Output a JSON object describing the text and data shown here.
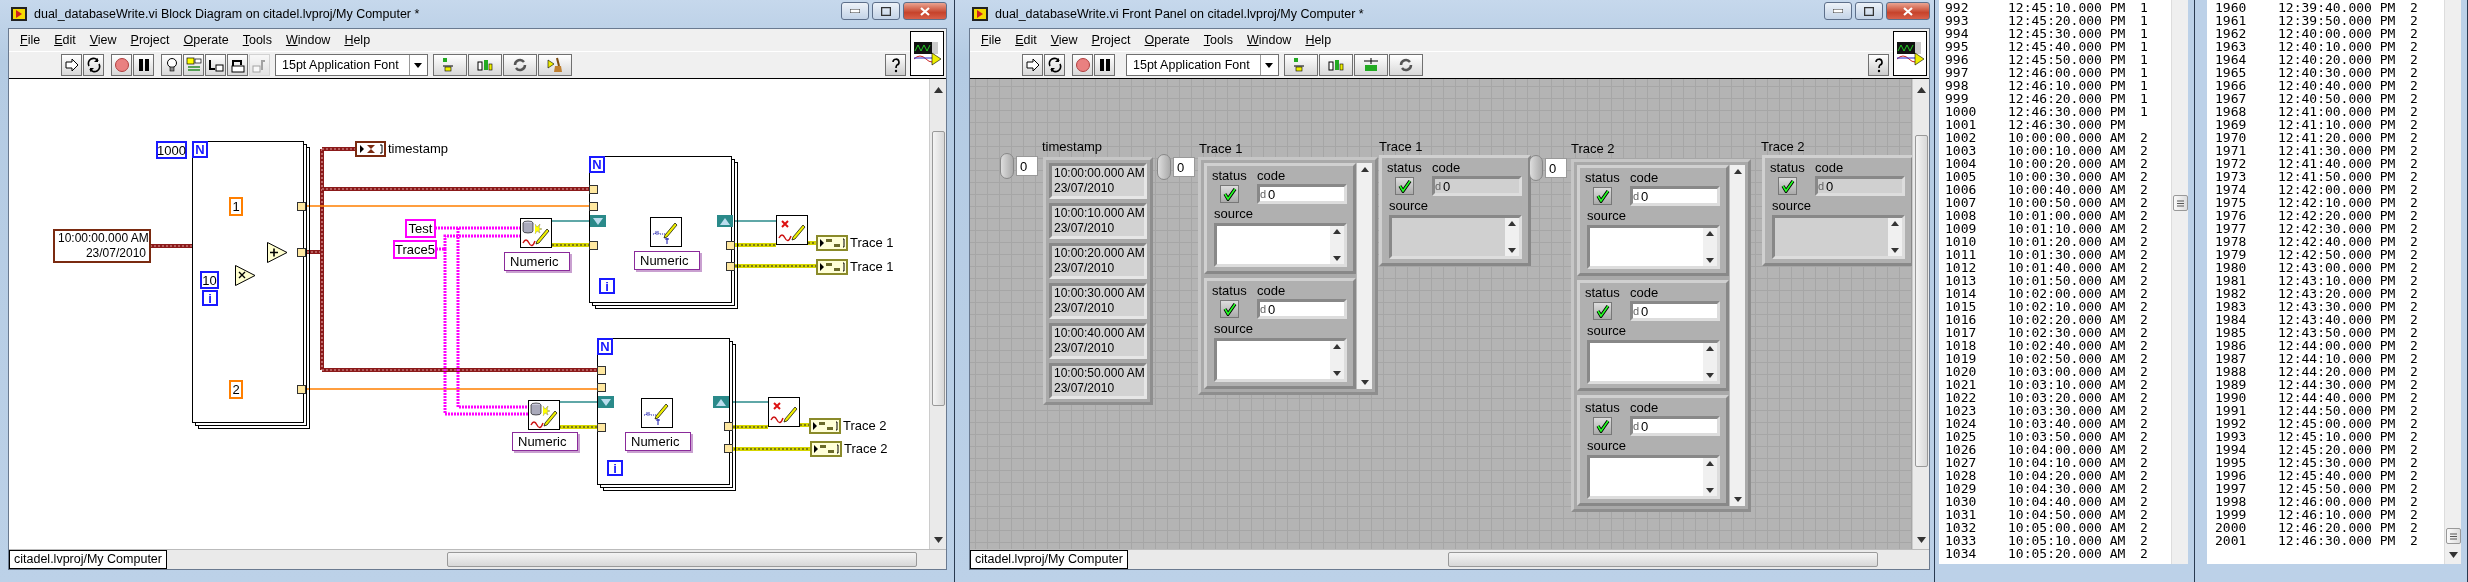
{
  "block_diagram": {
    "window_title": "dual_databaseWrite.vi Block Diagram on citadel.lvproj/My Computer *",
    "menu": [
      "File",
      "Edit",
      "View",
      "Project",
      "Operate",
      "Tools",
      "Window",
      "Help"
    ],
    "toolbar": {
      "buttons": [
        {
          "kind": "run",
          "disabled": false
        },
        {
          "kind": "run_continuously",
          "disabled": false
        },
        {
          "kind": "abort",
          "disabled": false
        },
        {
          "kind": "pause",
          "disabled": false
        },
        {
          "kind": "highlight",
          "disabled": false
        },
        {
          "kind": "retain_wire_values",
          "disabled": false
        },
        {
          "kind": "step_into",
          "disabled": false
        },
        {
          "kind": "step_over",
          "disabled": false
        },
        {
          "kind": "step_out",
          "disabled": true
        }
      ],
      "font": "15pt Application Font",
      "tools": [
        {
          "kind": "align",
          "disabled": false
        },
        {
          "kind": "distribute",
          "disabled": false
        },
        {
          "kind": "reorder",
          "disabled": false
        },
        {
          "kind": "clean_up",
          "disabled": false
        }
      ]
    },
    "loop_count_constant": "1000",
    "loops": [
      {
        "count_terminal": "N",
        "iteration_terminal": "i"
      },
      {
        "count_terminal": "N",
        "iteration_terminal": "i"
      },
      {
        "count_terminal": "N",
        "iteration_terminal": "i"
      }
    ],
    "timestamp_constant": [
      "10:00:00.000 AM",
      "23/07/2010"
    ],
    "array_constants": [
      "1",
      "2"
    ],
    "multiplier_constant": "10",
    "timestamp_indicator_label": "timestamp",
    "string_constants": [
      "Test",
      "Trace5"
    ],
    "type_selectors": [
      "Numeric",
      "Numeric",
      "Numeric",
      "Numeric"
    ],
    "error_indicator_labels": [
      "Trace 1",
      "Trace 1",
      "Trace 2",
      "Trace 2"
    ],
    "status_bar": "citadel.lvproj/My Computer"
  },
  "front_panel": {
    "window_title": "dual_databaseWrite.vi Front Panel on citadel.lvproj/My Computer *",
    "menu": [
      "File",
      "Edit",
      "View",
      "Project",
      "Operate",
      "Tools",
      "Window",
      "Help"
    ],
    "toolbar": {
      "buttons": [
        {
          "kind": "run",
          "disabled": false
        },
        {
          "kind": "run_continuously",
          "disabled": false
        },
        {
          "kind": "abort",
          "disabled": false
        },
        {
          "kind": "pause",
          "disabled": false
        }
      ],
      "font": "15pt Application Font",
      "tools": [
        {
          "kind": "align",
          "disabled": false
        },
        {
          "kind": "distribute",
          "disabled": false
        },
        {
          "kind": "resize",
          "disabled": false
        },
        {
          "kind": "reorder",
          "disabled": false
        }
      ]
    },
    "controls": [
      {
        "kind": "timestamp_array",
        "label": "timestamp",
        "index": "0",
        "elements": [
          [
            "10:00:00.000 AM",
            "23/07/2010"
          ],
          [
            "10:00:10.000 AM",
            "23/07/2010"
          ],
          [
            "10:00:20.000 AM",
            "23/07/2010"
          ],
          [
            "10:00:30.000 AM",
            "23/07/2010"
          ],
          [
            "10:00:40.000 AM",
            "23/07/2010"
          ],
          [
            "10:00:50.000 AM",
            "23/07/2010"
          ]
        ]
      },
      {
        "kind": "error_array",
        "label": "Trace 1",
        "index": "0",
        "elements": [
          {
            "status_label": "status",
            "status": true,
            "code_label": "code",
            "radix": "d",
            "code": "0",
            "source_label": "source"
          },
          {
            "status_label": "status",
            "status": true,
            "code_label": "code",
            "radix": "d",
            "code": "0",
            "source_label": "source"
          }
        ]
      },
      {
        "kind": "error_indicator",
        "label": "Trace 1",
        "element": {
          "status_label": "status",
          "status": true,
          "code_label": "code",
          "radix": "d",
          "code": "0",
          "source_label": "source"
        }
      },
      {
        "kind": "error_array",
        "label": "Trace 2",
        "index": "0",
        "elements": [
          {
            "status_label": "status",
            "status": true,
            "code_label": "code",
            "radix": "d",
            "code": "0",
            "source_label": "source"
          },
          {
            "status_label": "status",
            "status": true,
            "code_label": "code",
            "radix": "d",
            "code": "0",
            "source_label": "source"
          },
          {
            "status_label": "status",
            "status": true,
            "code_label": "code",
            "radix": "d",
            "code": "0",
            "source_label": "source"
          }
        ]
      },
      {
        "kind": "error_indicator",
        "label": "Trace 2",
        "element": {
          "status_label": "status",
          "status": true,
          "code_label": "code",
          "radix": "d",
          "code": "0",
          "source_label": "source"
        }
      }
    ],
    "status_bar": "citadel.lvproj/My Computer"
  },
  "log_windows": [
    {
      "rows": [
        [
          "992",
          "12:45:10.000 PM",
          "1"
        ],
        [
          "993",
          "12:45:20.000 PM",
          "1"
        ],
        [
          "994",
          "12:45:30.000 PM",
          "1"
        ],
        [
          "995",
          "12:45:40.000 PM",
          "1"
        ],
        [
          "996",
          "12:45:50.000 PM",
          "1"
        ],
        [
          "997",
          "12:46:00.000 PM",
          "1"
        ],
        [
          "998",
          "12:46:10.000 PM",
          "1"
        ],
        [
          "999",
          "12:46:20.000 PM",
          "1"
        ],
        [
          "1000",
          "12:46:30.000 PM",
          "1"
        ],
        [
          "1001",
          "12:46:30.000 PM"
        ],
        [
          "1002",
          "10:00:00.000 AM",
          "2"
        ],
        [
          "1003",
          "10:00:10.000 AM",
          "2"
        ],
        [
          "1004",
          "10:00:20.000 AM",
          "2"
        ],
        [
          "1005",
          "10:00:30.000 AM",
          "2"
        ],
        [
          "1006",
          "10:00:40.000 AM",
          "2"
        ],
        [
          "1007",
          "10:00:50.000 AM",
          "2"
        ],
        [
          "1008",
          "10:01:00.000 AM",
          "2"
        ],
        [
          "1009",
          "10:01:10.000 AM",
          "2"
        ],
        [
          "1010",
          "10:01:20.000 AM",
          "2"
        ],
        [
          "1011",
          "10:01:30.000 AM",
          "2"
        ],
        [
          "1012",
          "10:01:40.000 AM",
          "2"
        ],
        [
          "1013",
          "10:01:50.000 AM",
          "2"
        ],
        [
          "1014",
          "10:02:00.000 AM",
          "2"
        ],
        [
          "1015",
          "10:02:10.000 AM",
          "2"
        ],
        [
          "1016",
          "10:02:20.000 AM",
          "2"
        ],
        [
          "1017",
          "10:02:30.000 AM",
          "2"
        ],
        [
          "1018",
          "10:02:40.000 AM",
          "2"
        ],
        [
          "1019",
          "10:02:50.000 AM",
          "2"
        ],
        [
          "1020",
          "10:03:00.000 AM",
          "2"
        ],
        [
          "1021",
          "10:03:10.000 AM",
          "2"
        ],
        [
          "1022",
          "10:03:20.000 AM",
          "2"
        ],
        [
          "1023",
          "10:03:30.000 AM",
          "2"
        ],
        [
          "1024",
          "10:03:40.000 AM",
          "2"
        ],
        [
          "1025",
          "10:03:50.000 AM",
          "2"
        ],
        [
          "1026",
          "10:04:00.000 AM",
          "2"
        ],
        [
          "1027",
          "10:04:10.000 AM",
          "2"
        ],
        [
          "1028",
          "10:04:20.000 AM",
          "2"
        ],
        [
          "1029",
          "10:04:30.000 AM",
          "2"
        ],
        [
          "1030",
          "10:04:40.000 AM",
          "2"
        ],
        [
          "1031",
          "10:04:50.000 AM",
          "2"
        ],
        [
          "1032",
          "10:05:00.000 AM",
          "2"
        ],
        [
          "1033",
          "10:05:10.000 AM",
          "2"
        ],
        [
          "1034",
          "10:05:20.000 AM",
          "2"
        ]
      ]
    },
    {
      "rows": [
        [
          "1960",
          "12:39:40.000 PM",
          "2"
        ],
        [
          "1961",
          "12:39:50.000 PM",
          "2"
        ],
        [
          "1962",
          "12:40:00.000 PM",
          "2"
        ],
        [
          "1963",
          "12:40:10.000 PM",
          "2"
        ],
        [
          "1964",
          "12:40:20.000 PM",
          "2"
        ],
        [
          "1965",
          "12:40:30.000 PM",
          "2"
        ],
        [
          "1966",
          "12:40:40.000 PM",
          "2"
        ],
        [
          "1967",
          "12:40:50.000 PM",
          "2"
        ],
        [
          "1968",
          "12:41:00.000 PM",
          "2"
        ],
        [
          "1969",
          "12:41:10.000 PM",
          "2"
        ],
        [
          "1970",
          "12:41:20.000 PM",
          "2"
        ],
        [
          "1971",
          "12:41:30.000 PM",
          "2"
        ],
        [
          "1972",
          "12:41:40.000 PM",
          "2"
        ],
        [
          "1973",
          "12:41:50.000 PM",
          "2"
        ],
        [
          "1974",
          "12:42:00.000 PM",
          "2"
        ],
        [
          "1975",
          "12:42:10.000 PM",
          "2"
        ],
        [
          "1976",
          "12:42:20.000 PM",
          "2"
        ],
        [
          "1977",
          "12:42:30.000 PM",
          "2"
        ],
        [
          "1978",
          "12:42:40.000 PM",
          "2"
        ],
        [
          "1979",
          "12:42:50.000 PM",
          "2"
        ],
        [
          "1980",
          "12:43:00.000 PM",
          "2"
        ],
        [
          "1981",
          "12:43:10.000 PM",
          "2"
        ],
        [
          "1982",
          "12:43:20.000 PM",
          "2"
        ],
        [
          "1983",
          "12:43:30.000 PM",
          "2"
        ],
        [
          "1984",
          "12:43:40.000 PM",
          "2"
        ],
        [
          "1985",
          "12:43:50.000 PM",
          "2"
        ],
        [
          "1986",
          "12:44:00.000 PM",
          "2"
        ],
        [
          "1987",
          "12:44:10.000 PM",
          "2"
        ],
        [
          "1988",
          "12:44:20.000 PM",
          "2"
        ],
        [
          "1989",
          "12:44:30.000 PM",
          "2"
        ],
        [
          "1990",
          "12:44:40.000 PM",
          "2"
        ],
        [
          "1991",
          "12:44:50.000 PM",
          "2"
        ],
        [
          "1992",
          "12:45:00.000 PM",
          "2"
        ],
        [
          "1993",
          "12:45:10.000 PM",
          "2"
        ],
        [
          "1994",
          "12:45:20.000 PM",
          "2"
        ],
        [
          "1995",
          "12:45:30.000 PM",
          "2"
        ],
        [
          "1996",
          "12:45:40.000 PM",
          "2"
        ],
        [
          "1997",
          "12:45:50.000 PM",
          "2"
        ],
        [
          "1998",
          "12:46:00.000 PM",
          "2"
        ],
        [
          "1999",
          "12:46:10.000 PM",
          "2"
        ],
        [
          "2000",
          "12:46:20.000 PM",
          "2"
        ],
        [
          "2001",
          "12:46:30.000 PM",
          "2"
        ]
      ]
    }
  ]
}
